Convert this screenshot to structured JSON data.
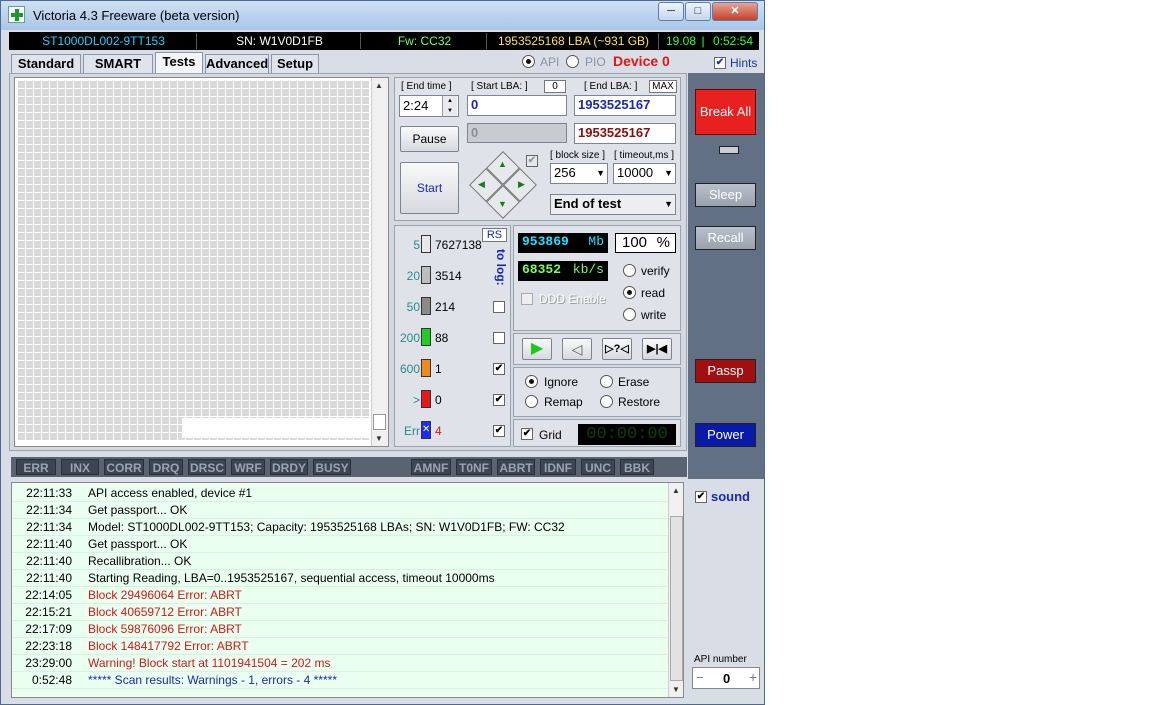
{
  "window": {
    "title": "Victoria 4.3 Freeware (beta version)"
  },
  "caption_buttons": {
    "minimize": "─",
    "maximize": "□",
    "close": "✕"
  },
  "info": {
    "model": "ST1000DL002-9TT153",
    "serial": "SN: W1V0D1FB",
    "firmware": "Fw: CC32",
    "capacity": "1953525168 LBA (~931 GB)",
    "date": "19.08",
    "time": "0:52:54"
  },
  "tabs": [
    "Standard",
    "SMART",
    "Tests",
    "Advanced",
    "Setup"
  ],
  "active_tab": "Tests",
  "mode": {
    "api": "API",
    "pio": "PIO",
    "device": "Device 0",
    "hints": "Hints"
  },
  "controls": {
    "end_time_label": "[ End time ]",
    "end_time_value": "2:24",
    "start_lba_label": "[ Start LBA: ]",
    "start_lba_zero": "0",
    "start_lba_value": "0",
    "start_lba_current": "0",
    "end_lba_label": "[ End LBA: ]",
    "end_lba_max": "MAX",
    "end_lba_value": "1953525167",
    "end_lba_current": "1953525167",
    "pause": "Pause",
    "start": "Start",
    "block_size_label": "[ block size ]",
    "block_size_value": "256",
    "timeout_label": "[ timeout,ms ]",
    "timeout_value": "10000",
    "end_action": "End of test",
    "rs": "RS",
    "to_log": "to log:"
  },
  "counters": [
    {
      "ms": "5",
      "count": "7627138",
      "color": "#e8e8e8",
      "log": null
    },
    {
      "ms": "20",
      "count": "3514",
      "color": "#bdbdbd",
      "log": null
    },
    {
      "ms": "50",
      "count": "214",
      "color": "#8a8a8a",
      "log": false
    },
    {
      "ms": "200",
      "count": "88",
      "color": "#22cc22",
      "log": false
    },
    {
      "ms": "600",
      "count": "1",
      "color": "#f08a1e",
      "log": true
    },
    {
      "ms": ">",
      "count": "0",
      "color": "#e81818",
      "log": true
    },
    {
      "ms": "Err",
      "count": "4",
      "color": "#1a2cff",
      "log": true
    }
  ],
  "progress": {
    "mb": "953869",
    "mb_unit": "Mb",
    "percent": "100",
    "percent_unit": "%",
    "speed": "68352",
    "speed_unit": "kb/s",
    "ddd": "DDD Enable"
  },
  "mode_radio": [
    "verify",
    "read",
    "write"
  ],
  "mode_selected": "read",
  "action_radio": [
    "Ignore",
    "Erase",
    "Remap",
    "Restore"
  ],
  "action_selected": "Ignore",
  "grid": {
    "label": "Grid",
    "timer": "00:00:00"
  },
  "status_flags_left": [
    "ERR",
    "INX",
    "CORR",
    "DRQ",
    "DRSC",
    "WRF",
    "DRDY",
    "BUSY"
  ],
  "status_flags_right": [
    "AMNF",
    "T0NF",
    "ABRT",
    "IDNF",
    "UNC",
    "BBK"
  ],
  "right_buttons": {
    "break_all": "Break All",
    "sleep": "Sleep",
    "recall": "Recall",
    "passp": "Passp",
    "power": "Power",
    "sound": "sound",
    "api_number_label": "API number",
    "api_number_value": "0"
  },
  "log": [
    {
      "time": "22:11:33",
      "msg": "API access enabled, device #1",
      "color": "#000000"
    },
    {
      "time": "22:11:34",
      "msg": "Get passport... OK",
      "color": "#000000"
    },
    {
      "time": "22:11:34",
      "msg": "Model: ST1000DL002-9TT153; Capacity: 1953525168 LBAs; SN: W1V0D1FB; FW: CC32",
      "color": "#000000"
    },
    {
      "time": "22:11:40",
      "msg": "Get passport... OK",
      "color": "#000000"
    },
    {
      "time": "22:11:40",
      "msg": "Recallibration... OK",
      "color": "#000000"
    },
    {
      "time": "22:11:40",
      "msg": "Starting Reading, LBA=0..1953525167, sequential access, timeout 10000ms",
      "color": "#000000"
    },
    {
      "time": "22:14:05",
      "msg": "Block 29496064 Error: ABRT",
      "color": "#d01818"
    },
    {
      "time": "22:15:21",
      "msg": "Block 40659712 Error: ABRT",
      "color": "#d01818"
    },
    {
      "time": "22:17:09",
      "msg": "Block 59876096 Error: ABRT",
      "color": "#d01818"
    },
    {
      "time": "22:23:18",
      "msg": "Block 148417792 Error: ABRT",
      "color": "#d01818"
    },
    {
      "time": "23:29:00",
      "msg": "Warning! Block start at 1101941504 = 202 ms",
      "color": "#d01818"
    },
    {
      "time": "0:52:48",
      "msg": "***** Scan results: Warnings - 1, errors - 4 *****",
      "color": "#1a28b0"
    }
  ]
}
